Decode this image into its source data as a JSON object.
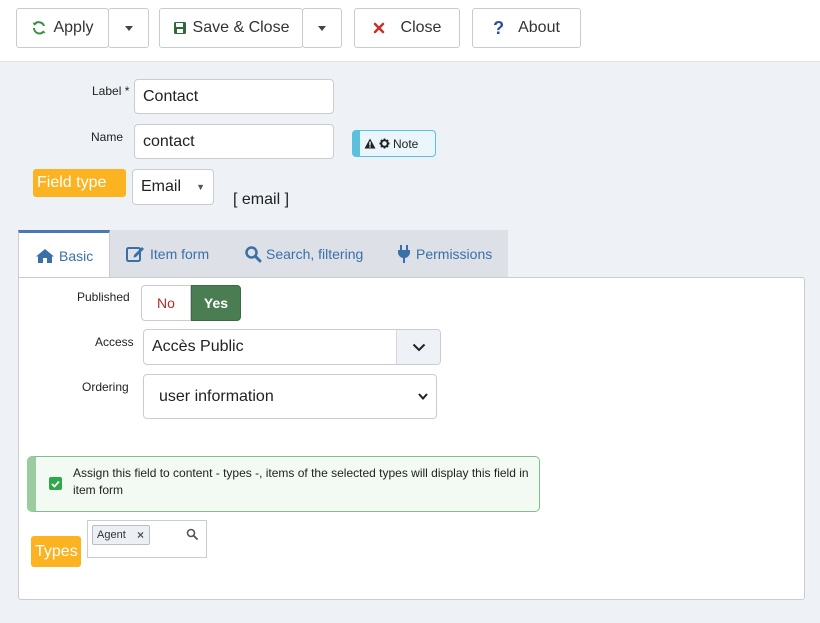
{
  "toolbar": {
    "apply_label": "Apply",
    "save_close_label": "Save & Close",
    "close_label": "Close",
    "about_label": "About"
  },
  "form": {
    "label_field_label": "Label *",
    "label_value": "Contact",
    "name_field_label": "Name",
    "name_value": "contact",
    "note_label": "Note",
    "field_type_label": "Field type",
    "field_type_value": "Email",
    "field_type_code": "[ email ]"
  },
  "tabs": [
    {
      "label": "Basic"
    },
    {
      "label": "Item form"
    },
    {
      "label": "Search, filtering"
    },
    {
      "label": "Permissions"
    }
  ],
  "basic": {
    "published_label": "Published",
    "no_label": "No",
    "yes_label": "Yes",
    "access_label": "Access",
    "access_value": "Accès Public",
    "ordering_label": "Ordering",
    "ordering_value": "user information",
    "assign_text": "Assign this field to content - types -, items of the selected types will display this field in item form",
    "types_label": "Types",
    "type_chip": "Agent"
  },
  "colors": {
    "accent_orange": "#fbb321",
    "yes_green": "#4a7d52",
    "tab_active_border": "#4a78b5",
    "note_teal": "#5bc0de",
    "info_green_border": "#7dbf86"
  }
}
